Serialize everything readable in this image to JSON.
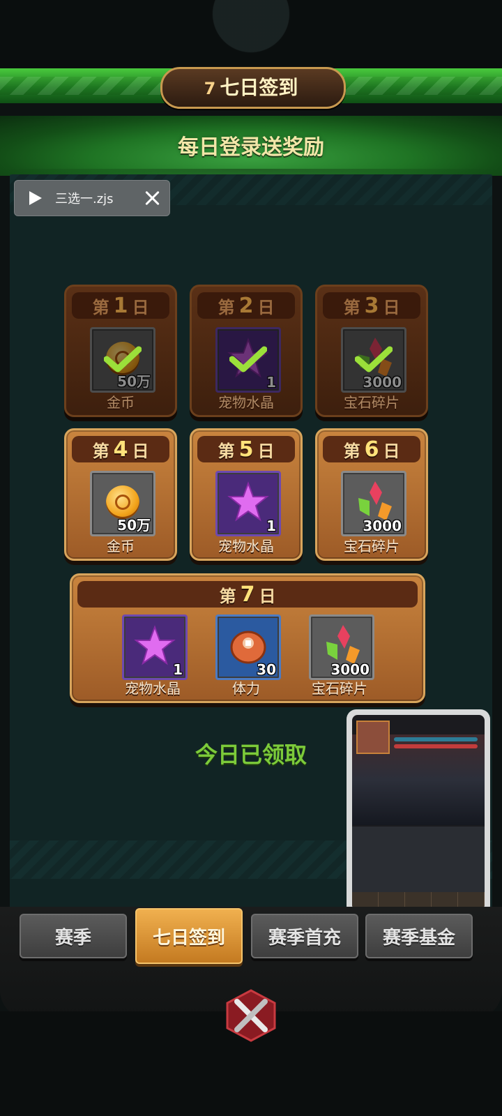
{
  "header": {
    "badge_number": "7",
    "title": "七日签到",
    "subtitle": "每日登录送奖励"
  },
  "toast": {
    "filename": "三选一.zjs"
  },
  "days": [
    {
      "prefix": "第",
      "num": "1",
      "suffix": "日",
      "item": "金币",
      "qty": "50万",
      "claimed": true
    },
    {
      "prefix": "第",
      "num": "2",
      "suffix": "日",
      "item": "宠物水晶",
      "qty": "1",
      "claimed": true
    },
    {
      "prefix": "第",
      "num": "3",
      "suffix": "日",
      "item": "宝石碎片",
      "qty": "3000",
      "claimed": true
    },
    {
      "prefix": "第",
      "num": "4",
      "suffix": "日",
      "item": "金币",
      "qty": "50万",
      "claimed": false
    },
    {
      "prefix": "第",
      "num": "5",
      "suffix": "日",
      "item": "宠物水晶",
      "qty": "1",
      "claimed": false
    },
    {
      "prefix": "第",
      "num": "6",
      "suffix": "日",
      "item": "宝石碎片",
      "qty": "3000",
      "claimed": false
    }
  ],
  "day7": {
    "prefix": "第",
    "num": "7",
    "suffix": "日",
    "rewards": [
      {
        "item": "宠物水晶",
        "qty": "1"
      },
      {
        "item": "体力",
        "qty": "30"
      },
      {
        "item": "宝石碎片",
        "qty": "3000"
      }
    ]
  },
  "status": {
    "today_text": "今日已领取"
  },
  "tabs": [
    {
      "label": "赛季",
      "active": false
    },
    {
      "label": "七日签到",
      "active": true
    },
    {
      "label": "赛季首充",
      "active": false
    },
    {
      "label": "赛季基金",
      "active": false
    }
  ],
  "colors": {
    "accent_green": "#7ccb3a",
    "active_tab": "#e7a43f",
    "panel": "#112424"
  }
}
